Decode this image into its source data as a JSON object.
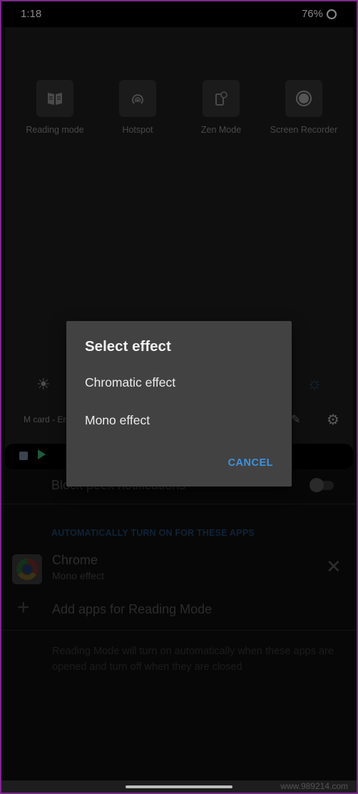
{
  "status_bar": {
    "time": "1:18",
    "battery": "76%"
  },
  "quick_settings": {
    "tiles": [
      {
        "label": "Reading mode",
        "icon": "book-icon"
      },
      {
        "label": "Hotspot",
        "icon": "hotspot-icon"
      },
      {
        "label": "Zen Mode",
        "icon": "zen-mode-icon"
      },
      {
        "label": "Screen Recorder",
        "icon": "record-icon"
      }
    ],
    "sim_text": "M card - Em",
    "brightness_icon": "☀",
    "auto_brightness_icon": "☼",
    "edit_icon": "✎",
    "settings_icon": "⚙"
  },
  "dialog": {
    "title": "Select effect",
    "options": [
      "Chromatic effect",
      "Mono effect"
    ],
    "cancel_label": "CANCEL",
    "accent_color": "#3d93e0"
  },
  "settings": {
    "block_peek_label": "Block peek notifications",
    "block_peek_enabled": false,
    "section_header": "AUTOMATICALLY TURN ON FOR THESE APPS",
    "apps": [
      {
        "name": "Chrome",
        "effect": "Mono effect"
      }
    ],
    "remove_icon": "✕",
    "add_icon": "+",
    "add_label": "Add apps for Reading Mode",
    "footnote": "Reading Mode will turn on automatically when these apps are opened and turn off when they are closed"
  },
  "watermark": "www.989214.com"
}
